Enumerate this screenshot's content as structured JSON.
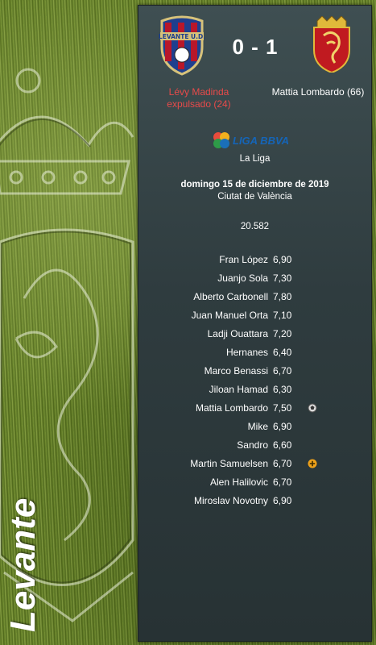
{
  "match": {
    "home_team": "Levante",
    "score": "0 - 1",
    "home_event": "Lévy Madinda expulsado (24)",
    "away_event": "Mattia Lombardo (66)",
    "home_crest_text": "LEVANTE U.D.",
    "league_logo_text": "LIGA BBVA",
    "competition": "La Liga",
    "date": "domingo 15 de diciembre de 2019",
    "stadium": "Ciutat de València",
    "attendance": "20.582"
  },
  "colors": {
    "event_red": "#e84a4a",
    "panel": "#2f3c3f",
    "goal_icon": "#dddddd",
    "sub_icon": "#f0a21a"
  },
  "players": [
    {
      "name": "Fran López",
      "rating": "6,90",
      "icon": ""
    },
    {
      "name": "Juanjo Sola",
      "rating": "7,30",
      "icon": ""
    },
    {
      "name": "Alberto Carbonell",
      "rating": "7,80",
      "icon": ""
    },
    {
      "name": "Juan Manuel Orta",
      "rating": "7,10",
      "icon": ""
    },
    {
      "name": "Ladji Ouattara",
      "rating": "7,20",
      "icon": ""
    },
    {
      "name": "Hernanes",
      "rating": "6,40",
      "icon": ""
    },
    {
      "name": "Marco Benassi",
      "rating": "6,70",
      "icon": ""
    },
    {
      "name": "Jiloan Hamad",
      "rating": "6,30",
      "icon": ""
    },
    {
      "name": "Mattia Lombardo",
      "rating": "7,50",
      "icon": "goal-ball-icon"
    },
    {
      "name": "Mike",
      "rating": "6,90",
      "icon": ""
    },
    {
      "name": "Sandro",
      "rating": "6,60",
      "icon": ""
    },
    {
      "name": "Martin Samuelsen",
      "rating": "6,70",
      "icon": "substitution-icon"
    },
    {
      "name": "Alen Halilovic",
      "rating": "6,70",
      "icon": ""
    },
    {
      "name": "Miroslav Novotny",
      "rating": "6,90",
      "icon": ""
    }
  ]
}
